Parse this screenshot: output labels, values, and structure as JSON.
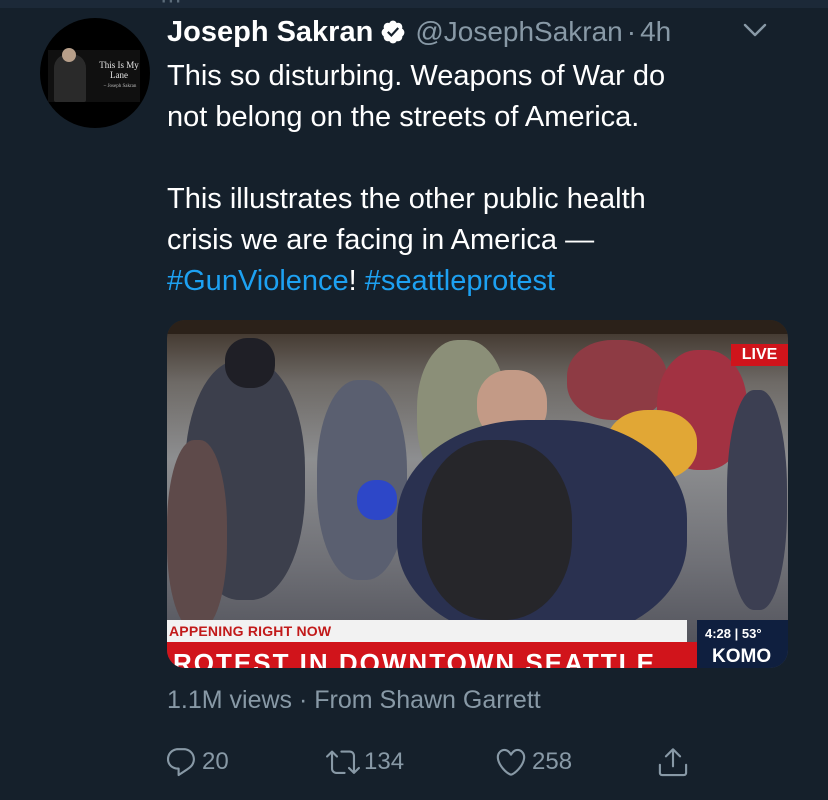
{
  "tweet": {
    "author_name": "Joseph Sakran",
    "handle": "@JosephSakran",
    "separator": "·",
    "time": "4h",
    "avatar_caption": "This Is My Lane",
    "avatar_sub": "~ Joseph Sakran",
    "text_line1": "This so disturbing.  Weapons of War do",
    "text_line2": "not belong on the streets of America.",
    "text_line3": "This illustrates the other public health",
    "text_line4": "crisis we are facing in America —",
    "hashtag1": "#GunViolence",
    "bang": "!",
    "hashtag2": "#seattleprotest"
  },
  "media": {
    "live_badge": "LIVE",
    "banner_top": "APPENING RIGHT NOW",
    "banner_main": "ROTEST IN DOWNTOWN SEATTLE",
    "clock": "4:28 | 53°",
    "station": "KOMO"
  },
  "meta": {
    "views": "1.1M views · From Shawn Garrett"
  },
  "actions": {
    "replies": "20",
    "retweets": "134",
    "likes": "258"
  },
  "colors": {
    "background": "#15202b",
    "link": "#1da1f2",
    "secondary_text": "#8899a6",
    "news_red": "#d1141b"
  },
  "icons": [
    "verified-badge-icon",
    "chevron-down-icon",
    "reply-icon",
    "retweet-icon",
    "like-icon",
    "share-icon"
  ]
}
